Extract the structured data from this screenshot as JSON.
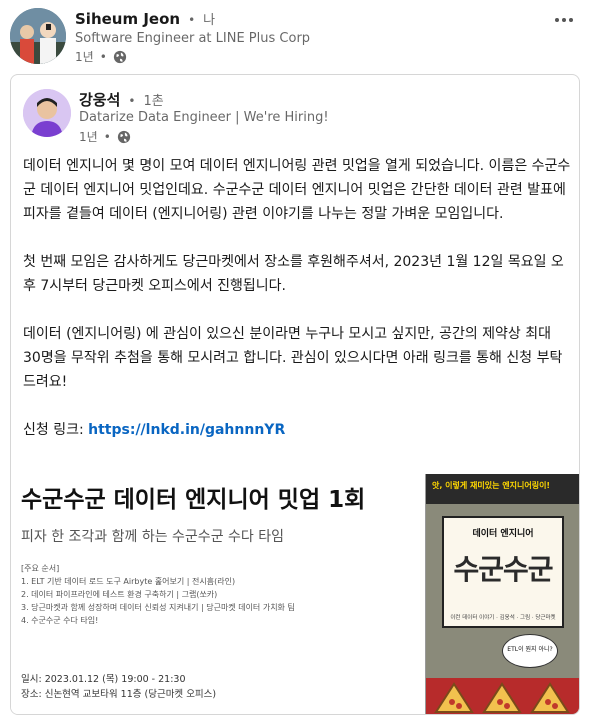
{
  "author": {
    "name": "Siheum Jeon",
    "separator": "•",
    "degree": "나",
    "headline": "Software Engineer at LINE Plus Corp",
    "time": "1년",
    "time_separator": "•",
    "avatar_icon": "profile-photo",
    "visibility_icon": "globe-icon",
    "more_icon": "more-horizontal-icon"
  },
  "shared_post": {
    "author_name": "강웅석",
    "separator": "•",
    "degree": "1촌",
    "headline": "Datarize Data Engineer | We're Hiring!",
    "time": "1년",
    "time_separator": "•",
    "avatar_icon": "profile-photo",
    "visibility_icon": "globe-icon",
    "paragraphs": [
      "데이터 엔지니어 몇 명이 모여 데이터 엔지니어링 관련 밋업을 열게 되었습니다. 이름은 수군수군 데이터 엔지니어 밋업인데요. 수군수군 데이터 엔지니어 밋업은 간단한 데이터 관련 발표에 피자를 곁들여 데이터 (엔지니어링) 관련 이야기를 나누는 정말 가벼운 모임입니다.",
      "첫 번째 모임은 감사하게도 당근마켓에서 장소를 후원해주셔서, 2023년 1월 12일 목요일 오후 7시부터 당근마켓 오피스에서 진행됩니다.",
      "데이터 (엔지니어링) 에 관심이 있으신 분이라면 누구나 모시고 싶지만, 공간의 제약상 최대 30명을 무작위 추첨을 통해 모시려고 합니다. 관심이 있으시다면 아래 링크를 통해 신청 부탁드려요!"
    ],
    "signup_label": "신청 링크: ",
    "signup_link": "https://lnkd.in/gahnnnYR"
  },
  "banner": {
    "title": "수군수군 데이터 엔지니어 밋업 1회",
    "subtitle": "피자 한 조각과 함께 하는 수군수군 수다 타임",
    "agenda_header": "[주요 순서]",
    "agenda": [
      "1. ELT 기반 데이터 로드 도구 Airbyte 훑어보기 | 전시흠(라인)",
      "2. 데이터 파이프라인에 테스트 환경 구축하기 | 그랩(쏘카)",
      "3. 당근마켓과 함께 성장하며 데이터 신뢰성 지켜내기 | 당근마켓 데이터 가치화 팀",
      "4. 수군수군 수다 타임!"
    ],
    "date_line": "일시: 2023.01.12 (목) 19:00 - 21:30",
    "place_line": "장소: 신논현역 교보타워 11층 (당근마켓 오피스)",
    "poster": {
      "tag": "앗, 이렇게 재미있는 엔지니어링이!",
      "label": "데이터 엔지니어",
      "big_title": "수군수군",
      "note": "이런 데이터 이야기 · 김웅석 · 그림 · 당근마켓",
      "bubble": "ETL이 뭔지 아니?"
    }
  }
}
